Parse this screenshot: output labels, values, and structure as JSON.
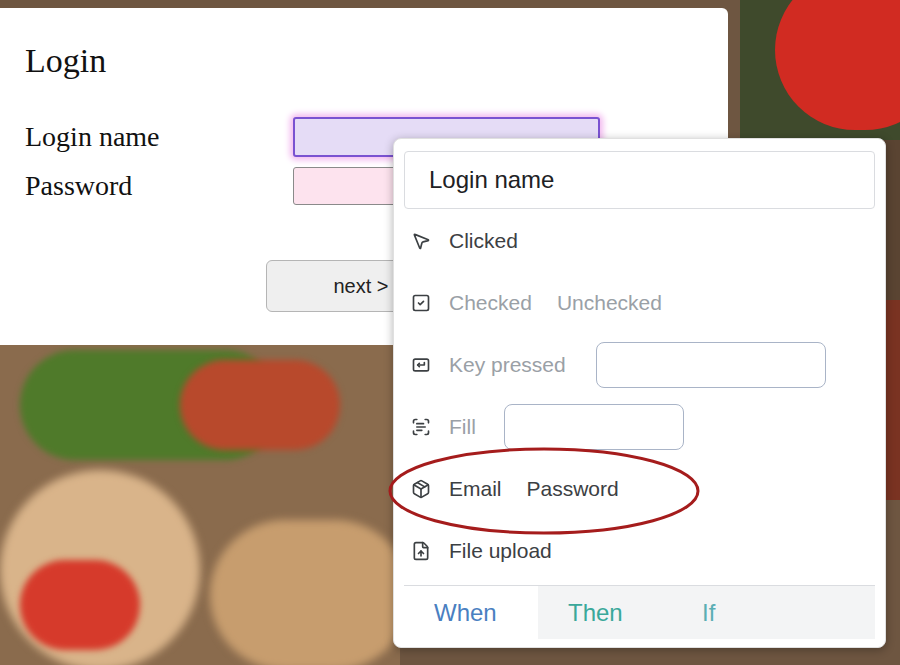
{
  "login": {
    "title": "Login",
    "fields": [
      {
        "label": "Login name",
        "value": "",
        "focused": true
      },
      {
        "label": "Password",
        "value": "",
        "focused": false
      }
    ],
    "button": "next >"
  },
  "menu": {
    "search": {
      "value": "Login name"
    },
    "items": [
      {
        "kind": "click",
        "options": [
          {
            "label": "Clicked",
            "disabled": false
          }
        ],
        "highlighted": false
      },
      {
        "kind": "check",
        "options": [
          {
            "label": "Checked",
            "disabled": true
          },
          {
            "label": "Unchecked",
            "disabled": true
          }
        ],
        "highlighted": false
      },
      {
        "kind": "key",
        "options": [
          {
            "label": "Key pressed",
            "disabled": true
          }
        ],
        "input": {
          "value": ""
        },
        "highlighted": false
      },
      {
        "kind": "fill",
        "options": [
          {
            "label": "Fill",
            "disabled": true
          }
        ],
        "input": {
          "value": ""
        },
        "highlighted": false
      },
      {
        "kind": "generate",
        "options": [
          {
            "label": "Email",
            "disabled": false
          },
          {
            "label": "Password",
            "disabled": false
          }
        ],
        "highlighted": true
      },
      {
        "kind": "upload",
        "options": [
          {
            "label": "File upload",
            "disabled": false
          }
        ],
        "highlighted": false
      }
    ],
    "tabs": [
      {
        "label": "When",
        "selected": true,
        "color": "#4a7fc1"
      },
      {
        "label": "Then",
        "selected": false,
        "color": "#3aa89a"
      },
      {
        "label": "If",
        "selected": false,
        "color": "#5aaeb4"
      }
    ]
  }
}
